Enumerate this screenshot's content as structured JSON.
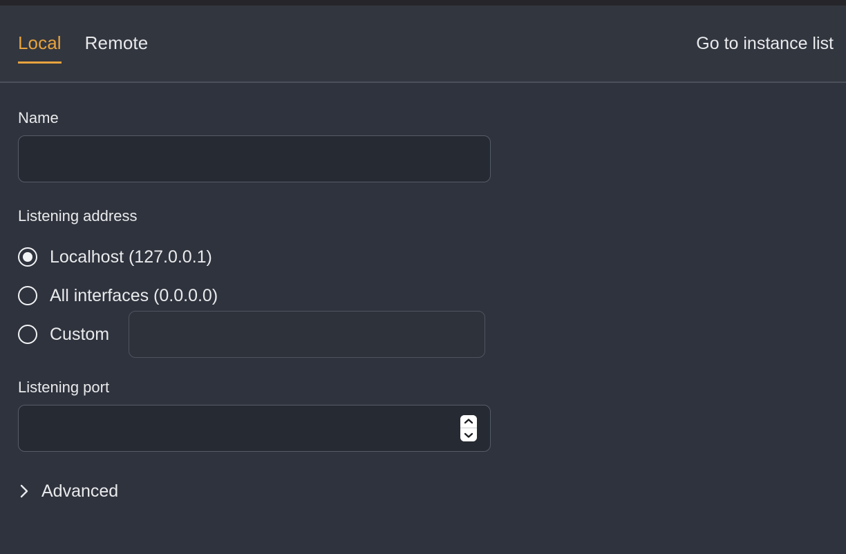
{
  "window": {
    "accent_color": "#e8a33d",
    "background_color": "#2f333d",
    "header_background": "#32363f",
    "input_background": "#262a33",
    "text_color": "#e9eaec"
  },
  "header": {
    "tabs": [
      {
        "label": "Local",
        "active": true
      },
      {
        "label": "Remote",
        "active": false
      }
    ],
    "instance_list_link": "Go to instance list"
  },
  "form": {
    "name": {
      "label": "Name",
      "value": "",
      "placeholder": ""
    },
    "listening_address": {
      "label": "Listening address",
      "selected": "localhost",
      "options": [
        {
          "id": "localhost",
          "label": "Localhost (127.0.0.1)",
          "checked": true
        },
        {
          "id": "all",
          "label": "All interfaces (0.0.0.0)",
          "checked": false
        },
        {
          "id": "custom",
          "label": "Custom",
          "checked": false
        }
      ],
      "custom_value": "",
      "custom_placeholder": ""
    },
    "listening_port": {
      "label": "Listening port",
      "value": "",
      "placeholder": "",
      "spinner_up_icon": "chevron-up-icon",
      "spinner_down_icon": "chevron-down-icon"
    },
    "advanced": {
      "label": "Advanced",
      "expanded": false,
      "icon": "chevron-right-icon"
    }
  }
}
